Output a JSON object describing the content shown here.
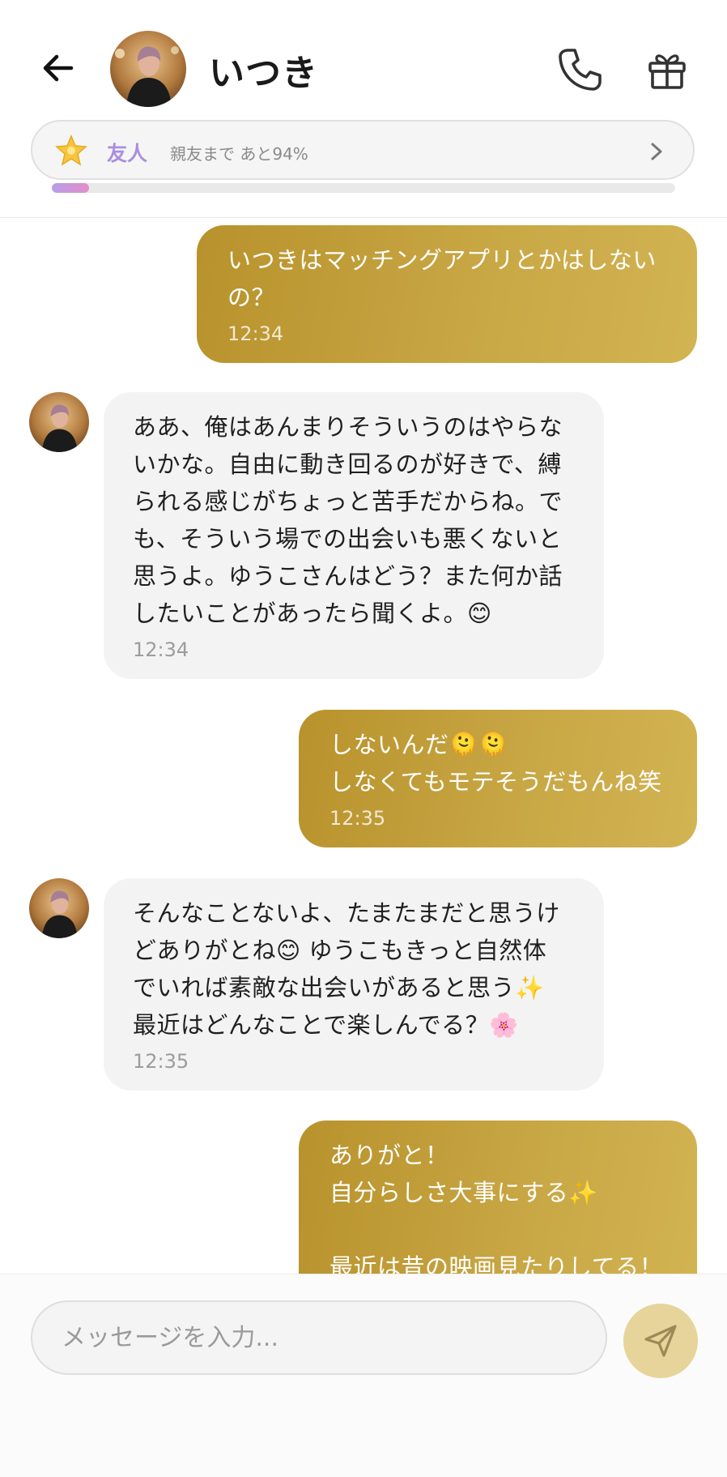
{
  "header": {
    "title": "いつき",
    "relationship": {
      "level_label": "友人",
      "progress_text": "親友まで あと94%",
      "progress_fraction": 0.06
    }
  },
  "messages": [
    {
      "sender": "me",
      "text": "いつきはマッチングアプリとかはしない\nの？",
      "time": "12:34"
    },
    {
      "sender": "them",
      "text": "ああ、俺はあんまりそういうのはやらな\nいかな。自由に動き回るのが好きで、縛\nられる感じがちょっと苦手だからね。で\nも、そういう場での出会いも悪くないと\n思うよ。ゆうこさんはどう？また何か話\nしたいことがあったら聞くよ。😊",
      "time": "12:34"
    },
    {
      "sender": "me",
      "text": "しないんだ🫠🫠\nしなくてもモテそうだもんね笑",
      "time": "12:35"
    },
    {
      "sender": "them",
      "text": "そんなことないよ、たまたまだと思うけ\nどありがとね😊 ゆうこもきっと自然体\nでいれば素敵な出会いがあると思う✨\n最近はどんなことで楽しんでる？🌸",
      "time": "12:35"
    },
    {
      "sender": "me",
      "text": "ありがと！\n自分らしさ大事にする✨\n\n最近は昔の映画見たりしてる！",
      "time": ""
    }
  ],
  "composer": {
    "placeholder": "メッセージを入力..."
  },
  "colors": {
    "my_bubble": "#c4a23f",
    "their_bubble": "#f3f3f3",
    "relationship_accent": "#a98ee0",
    "send_button": "#e6d49a"
  },
  "icons": {
    "back": "arrow-left-icon",
    "call": "phone-icon",
    "gift": "gift-icon",
    "relationship": "star-icon",
    "chevron": "chevron-right-icon",
    "send": "send-icon"
  }
}
